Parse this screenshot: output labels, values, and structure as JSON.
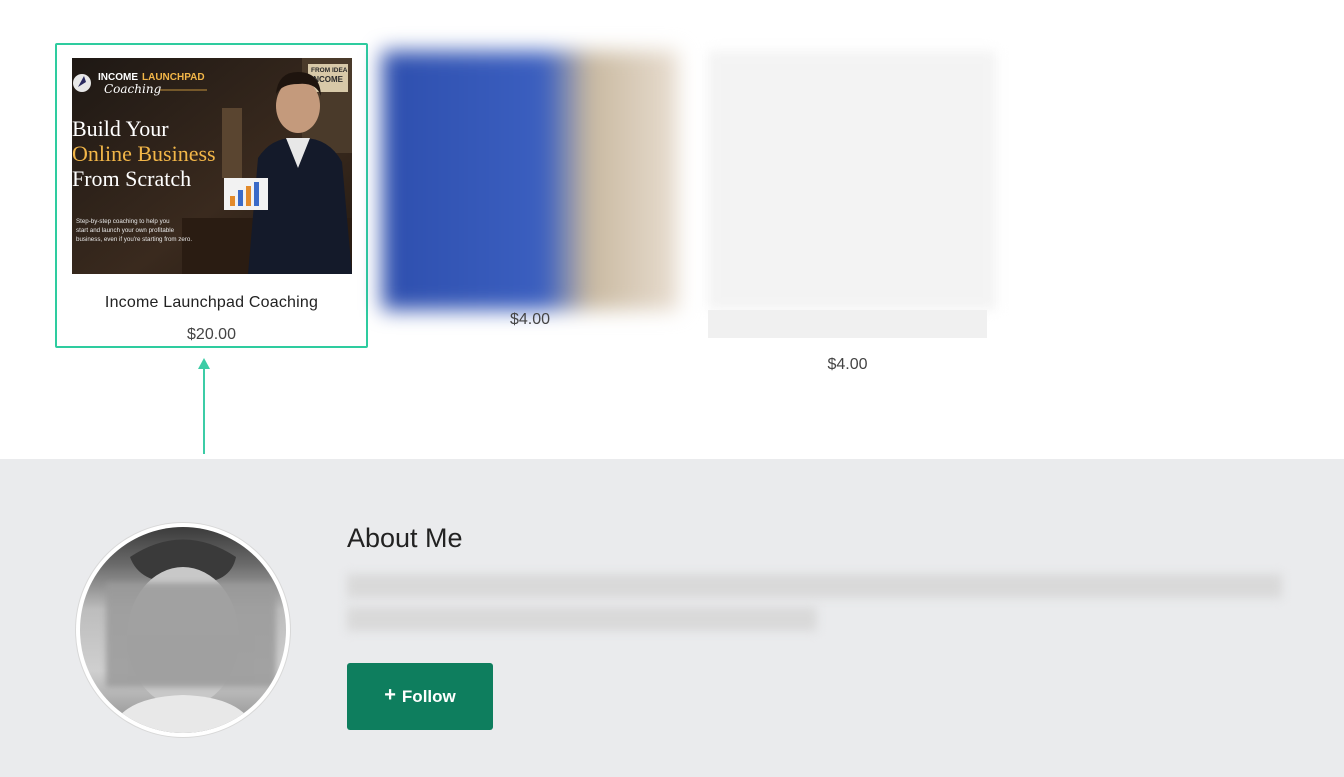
{
  "products": [
    {
      "title": "Income Launchpad Coaching",
      "price": "$20.00",
      "image": {
        "brand_top": "INCOME",
        "brand_accent": "LAUNCHPAD",
        "brand_sub": "Coaching",
        "headline_1": "Build Your",
        "headline_2": "Online Business",
        "headline_3": "From Scratch",
        "tagline_1": "Step-by-step coaching to help you",
        "tagline_2": "start and launch your own profitable",
        "tagline_3": "business, even if you're starting from zero.",
        "poster_1": "FROM IDEA",
        "poster_2": "INCOME"
      }
    },
    {
      "title": "",
      "price": "$4.00"
    },
    {
      "title": "",
      "price": "$4.00"
    }
  ],
  "about": {
    "title": "About Me",
    "follow_label": "Follow",
    "follow_icon": "plus-icon"
  },
  "colors": {
    "highlight": "#2ecc9f",
    "follow_button": "#0e7e5e",
    "about_bg": "#eaebed"
  }
}
